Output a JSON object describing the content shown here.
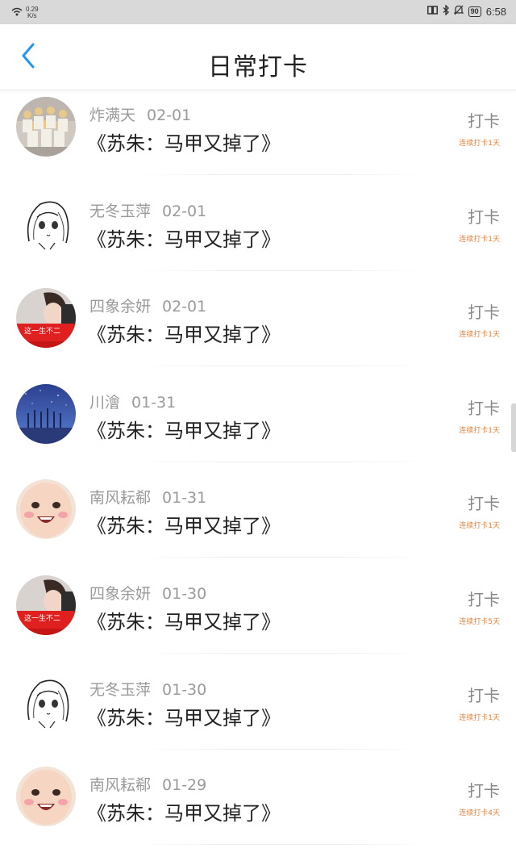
{
  "status_bar": {
    "net_speed_value": "0.29",
    "net_speed_unit": "K/s",
    "battery": "90",
    "time": "6:58"
  },
  "header": {
    "title": "日常打卡"
  },
  "checkins": [
    {
      "name": "炸满天",
      "date": "02-01",
      "content": "《苏朱：马甲又掉了》",
      "action": "打卡",
      "streak": "连续打卡1天",
      "avatar": "group-photo"
    },
    {
      "name": "无冬玉萍",
      "date": "02-01",
      "content": "《苏朱：马甲又掉了》",
      "action": "打卡",
      "streak": "连续打卡1天",
      "avatar": "anime-sketch"
    },
    {
      "name": "四象余妍",
      "date": "02-01",
      "content": "《苏朱：马甲又掉了》",
      "action": "打卡",
      "streak": "连续打卡1天",
      "avatar": "portrait-red"
    },
    {
      "name": "川澮",
      "date": "01-31",
      "content": "《苏朱：马甲又掉了》",
      "action": "打卡",
      "streak": "连续打卡1天",
      "avatar": "starry-night"
    },
    {
      "name": "南风耘郗",
      "date": "01-31",
      "content": "《苏朱：马甲又掉了》",
      "action": "打卡",
      "streak": "连续打卡1天",
      "avatar": "baby-face"
    },
    {
      "name": "四象余妍",
      "date": "01-30",
      "content": "《苏朱：马甲又掉了》",
      "action": "打卡",
      "streak": "连续打卡5天",
      "avatar": "portrait-red"
    },
    {
      "name": "无冬玉萍",
      "date": "01-30",
      "content": "《苏朱：马甲又掉了》",
      "action": "打卡",
      "streak": "连续打卡1天",
      "avatar": "anime-sketch"
    },
    {
      "name": "南风耘郗",
      "date": "01-29",
      "content": "《苏朱：马甲又掉了》",
      "action": "打卡",
      "streak": "连续打卡4天",
      "avatar": "baby-face"
    }
  ],
  "colors": {
    "accent": "#2196f3",
    "streak": "#e8803a",
    "name": "#9a9a9a",
    "status_bar_bg": "#d9d9d9"
  }
}
